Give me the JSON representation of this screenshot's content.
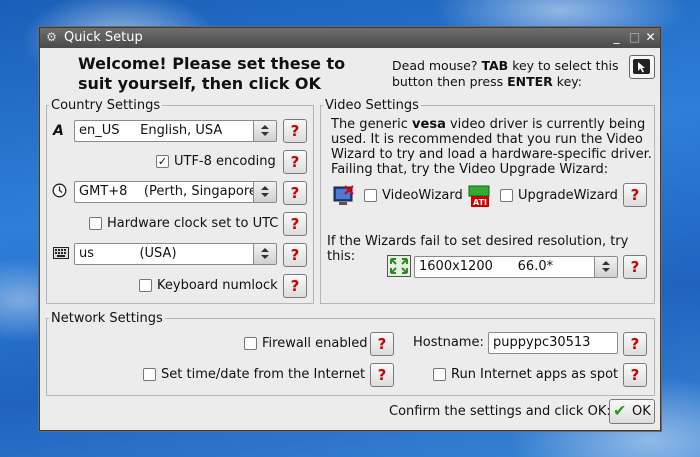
{
  "window": {
    "title": "Quick Setup",
    "title_icon": "gear-icon",
    "minimize": "_",
    "maximize": "□",
    "close": "✕"
  },
  "header": {
    "welcome_line1": "Welcome! Please set these to",
    "welcome_line2": "suit yourself, then click OK",
    "dead_mouse_line1": "Dead mouse? TAB key to select this",
    "dead_mouse_line2": "button then press ENTER key:"
  },
  "country": {
    "legend": "Country Settings",
    "locale_value": "en_US     English, USA",
    "utf8_label": "UTF-8 encoding",
    "utf8_checked": true,
    "timezone_value": "GMT+8    (Perth, Singapore",
    "hwclock_label": "Hardware clock set to UTC",
    "hwclock_checked": false,
    "keyboard_value": "us           (USA)",
    "numlock_label": "Keyboard numlock",
    "numlock_checked": false,
    "help_glyph": "?"
  },
  "video": {
    "legend": "Video Settings",
    "desc_line1_pre": "The generic ",
    "desc_line1_bold": "vesa",
    "desc_line1_post": " video driver is currently being",
    "desc_line2": "used. It is recommended that you run the Video",
    "desc_line3": "Wizard to try and load a hardware-specific driver.",
    "desc_line4": "Failing that, try the Video Upgrade Wizard:",
    "videowizard_label": "VideoWizard",
    "upgradewizard_label": "UpgradeWizard",
    "fallback_text": "If the Wizards fail to set desired resolution, try this:",
    "resolution_value": "1600x1200      66.0*"
  },
  "network": {
    "legend": "Network Settings",
    "firewall_label": "Firewall enabled",
    "hostname_label": "Hostname:",
    "hostname_value": "puppypc30513",
    "settime_label": "Set time/date from the Internet",
    "spot_label": "Run Internet apps as spot"
  },
  "footer": {
    "confirm_text": "Confirm the settings and click OK:",
    "ok_label": "OK"
  }
}
